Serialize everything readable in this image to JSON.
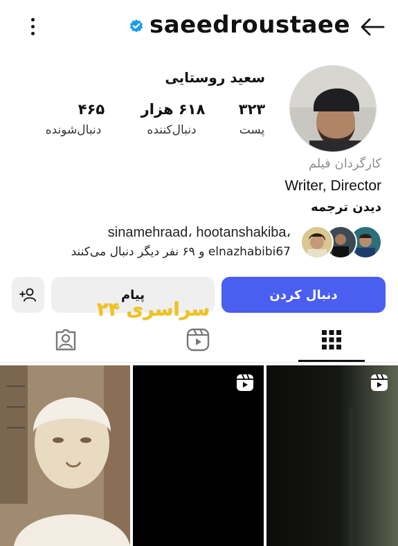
{
  "header": {
    "username": "saeedroustaee",
    "verified_icon": "verified-badge-icon",
    "more_icon": "more-vertical-icon",
    "back_icon": "arrow-back-icon"
  },
  "profile": {
    "full_name": "سعید روستایی",
    "stats": [
      {
        "value": "۳۲۳",
        "label": "پست"
      },
      {
        "value": "۶۱۸ هزار",
        "label": "دنبال‌کننده"
      },
      {
        "value": "۴۶۵",
        "label": "دنبال‌شونده"
      }
    ],
    "category": "کارگردان فیلم",
    "bio": "Writer, Director",
    "see_translation": "دیدن ترجمه",
    "followed_by_line1": "sinamehraad، hootanshakiba،",
    "followed_by_line2": "elnazhabibi67 و ۶۹ نفر دیگر دنبال می‌کنند"
  },
  "actions": {
    "follow_label": "دنبال کردن",
    "message_label": "پیام",
    "add_user_icon": "add-person-icon"
  },
  "watermark": "سراسری ۲۴",
  "tabs": [
    {
      "icon": "grid-icon",
      "active": true
    },
    {
      "icon": "reels-icon",
      "active": false
    },
    {
      "icon": "tagged-icon",
      "active": false
    }
  ],
  "colors": {
    "accent": "#4a5ef0",
    "verified": "#1d9bf0",
    "button_gray": "#efefef",
    "watermark": "#f0c21b"
  }
}
